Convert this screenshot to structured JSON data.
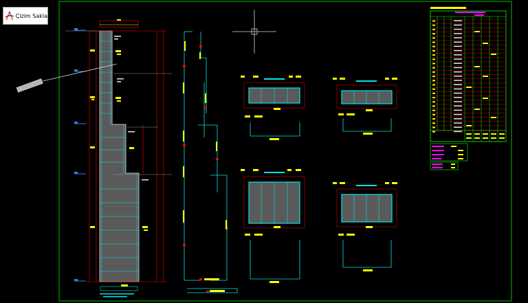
{
  "app": {
    "logo_text": "Çizim Sakla",
    "logo_icon": "compass-a-logo-icon"
  },
  "drawing": {
    "canvas_bg": "#000000",
    "frame_color": "#00a000",
    "accent_colors": {
      "outline": "#e8e8e8",
      "rebar": "#00e6e6",
      "dimension": "#ff0000",
      "label": "#ffff00",
      "level": "#2f7dff",
      "table_line": "#ff0000",
      "table_text": "#ff00ff",
      "table_border": "#00ff00"
    }
  },
  "cursor": {
    "icon": "crosshair-cursor-icon"
  }
}
